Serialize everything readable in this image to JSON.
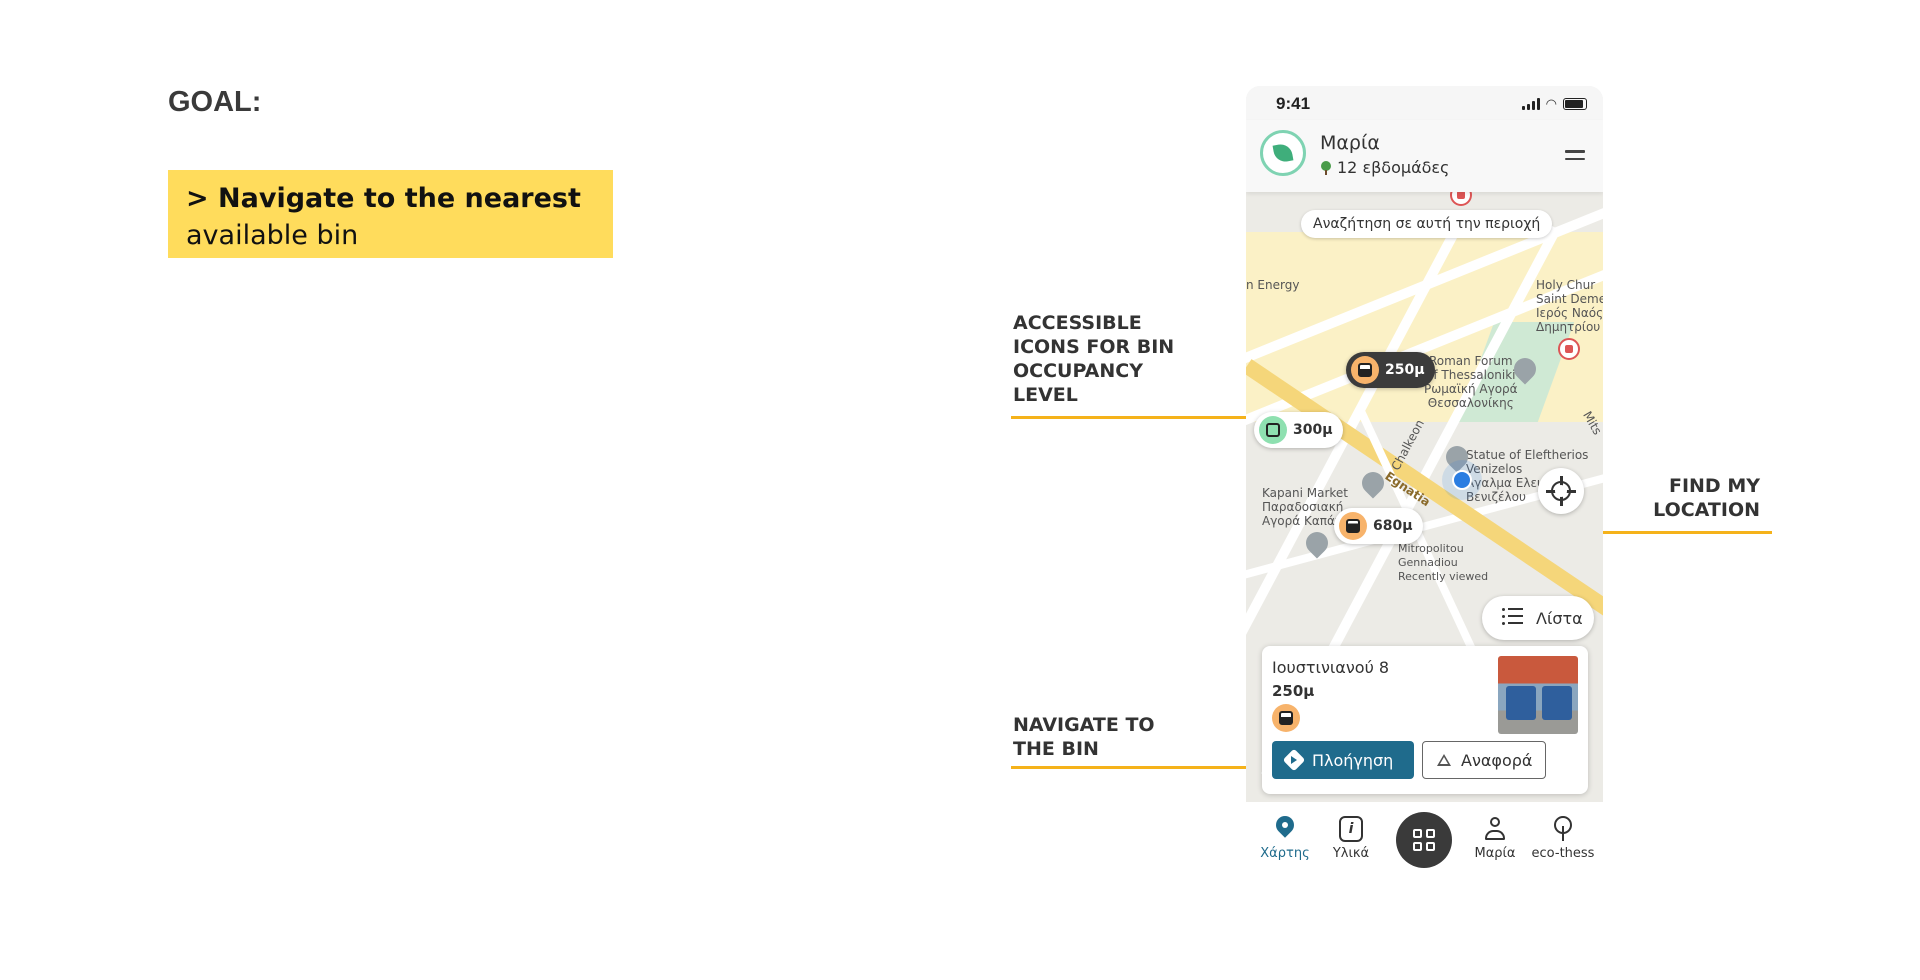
{
  "goal": {
    "title": "GOAL:",
    "line1": "> Navigate to the nearest",
    "line2": "available bin"
  },
  "annotations": {
    "icons": [
      "ACCESSIBLE",
      "ICONS FOR BIN",
      "OCCUPANCY",
      "LEVEL"
    ],
    "location": [
      "FIND MY",
      "LOCATION"
    ],
    "navigate": [
      "NAVIGATE TO",
      "THE BIN"
    ]
  },
  "status_bar": {
    "time": "9:41"
  },
  "header": {
    "user_name": "Μαρία",
    "weeks": "12 εβδομάδες"
  },
  "map": {
    "search_area": "Αναζήτηση σε αυτή την περιοχή",
    "labels": {
      "energy": "n Energy",
      "church": "Holy Chur\nSaint Deme\nΙερός Ναός\nΔημητρίου Πολιο",
      "forum": "Roman Forum\nof Thessaloniki\nΡωμαϊκή Αγορά\nΘεσσαλονίκης",
      "statue": "Statue of Eleftherios\nVenizelos\nΆγαλμα Ελευθερίο\nΒενιζέλου",
      "kapani": "Kapani Market\nΠαραδοσιακή\nΑγορά Καπάνι",
      "chalkeon": "Chalkeon",
      "egnatia": "Egnatia",
      "mitropolitou": "Mitropolitou\nGennadiou\nRecently viewed",
      "mits": "Mits"
    },
    "pins": [
      {
        "distance": "250μ",
        "level": "half",
        "selected": true
      },
      {
        "distance": "300μ",
        "level": "empty",
        "selected": false
      },
      {
        "distance": "680μ",
        "level": "full",
        "selected": false
      }
    ],
    "list_button": "Λίστα"
  },
  "card": {
    "address": "Ιουστινιανού 8",
    "distance": "250μ",
    "navigate_label": "Πλοήγηση",
    "report_label": "Αναφορά"
  },
  "bottom_nav": {
    "items": [
      "Χάρτης",
      "Υλικά",
      "Μαρία",
      "eco-thess"
    ],
    "active": "Χάρτης"
  },
  "colors": {
    "accent": "#1f6b8c",
    "goal_highlight": "#ffdc5c",
    "annotation_arrow": "#f5b21a",
    "bin_half": "#f7b36b",
    "bin_empty": "#8ee0b0"
  },
  "icons": [
    "leaf-icon",
    "tree-icon",
    "menu-icon",
    "crosshair-icon",
    "list-icon",
    "directions-icon",
    "warning-icon",
    "map-pin-icon",
    "info-icon",
    "qr-icon",
    "user-icon"
  ]
}
